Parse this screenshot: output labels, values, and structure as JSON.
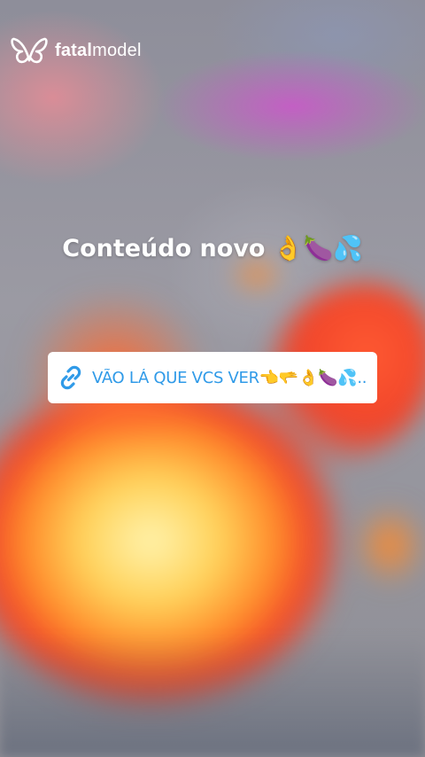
{
  "brand": {
    "name_bold": "fatal",
    "name_light": "model",
    "icon": "butterfly-icon"
  },
  "story": {
    "headline": "Conteúdo novo 👌🍆💦"
  },
  "link_sticker": {
    "icon": "link-icon",
    "text": "VÃO LÁ QUE VCS VER👈🫳👌🍆💦..."
  },
  "colors": {
    "link_text": "#2f9ae8",
    "sticker_bg": "#ffffff",
    "text": "#ffffff"
  }
}
